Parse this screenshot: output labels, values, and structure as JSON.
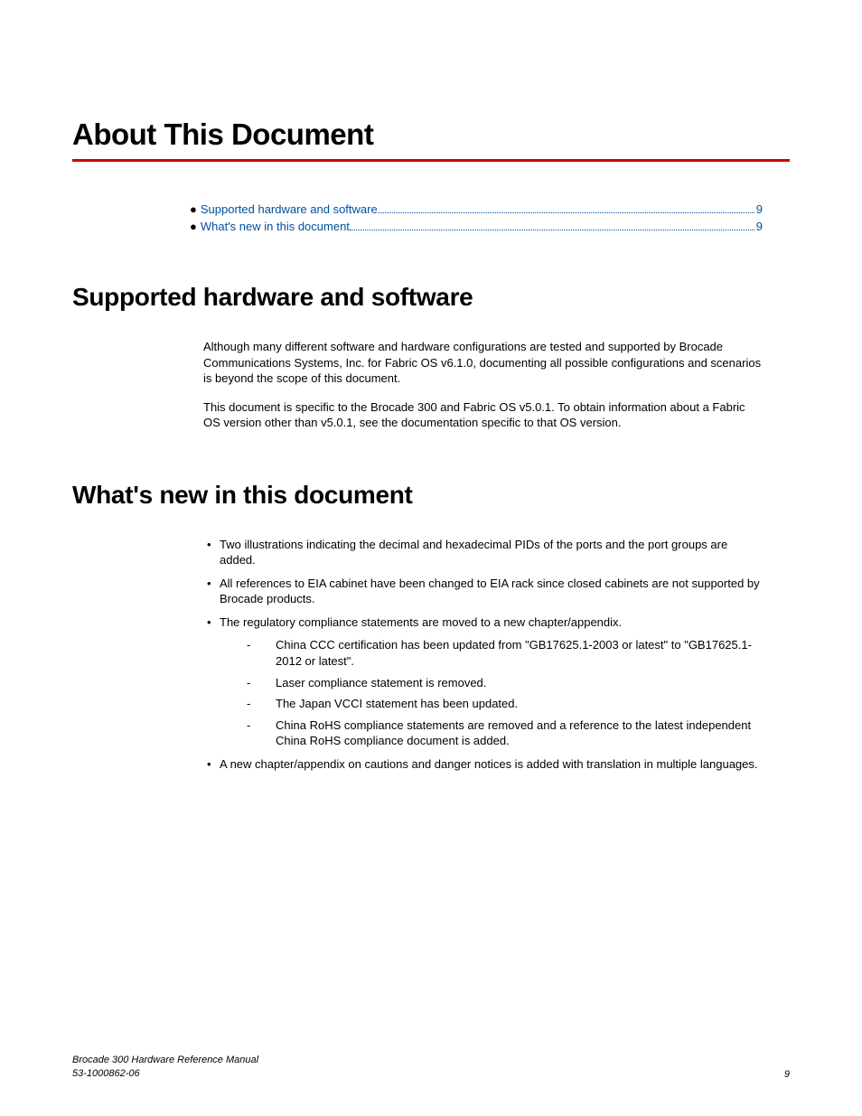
{
  "title": "About This Document",
  "toc": [
    {
      "label": "Supported hardware and software",
      "page": "9"
    },
    {
      "label": "What's new in this document",
      "page": "9"
    }
  ],
  "section1": {
    "heading": "Supported hardware and software",
    "p1": "Although many different software and hardware configurations are tested and supported by Brocade Communications Systems, Inc. for Fabric OS v6.1.0, documenting all possible configurations and scenarios is beyond the scope of this document.",
    "p2": "This document is specific to the Brocade 300 and Fabric OS v5.0.1. To obtain information about a Fabric OS version other than v5.0.1, see the documentation specific to that OS version."
  },
  "section2": {
    "heading": "What's new in this document",
    "bullets": [
      "Two illustrations indicating the decimal and hexadecimal PIDs of the ports and the port groups are added.",
      "All references to EIA cabinet have been changed to EIA rack since closed cabinets are not supported by Brocade products.",
      "The regulatory compliance statements are moved to a new chapter/appendix."
    ],
    "subbullets": [
      "China CCC certification has been updated from \"GB17625.1-2003 or latest\" to \"GB17625.1-2012 or latest\".",
      "Laser compliance statement is removed.",
      "The Japan VCCI statement has been updated.",
      "China RoHS compliance statements are removed and a reference to the latest independent China RoHS compliance document is added."
    ],
    "bullet4": "A new chapter/appendix on cautions and danger notices is added with translation in multiple languages."
  },
  "footer": {
    "line1": "Brocade 300 Hardware Reference Manual",
    "line2": "53-1000862-06",
    "page": "9"
  }
}
